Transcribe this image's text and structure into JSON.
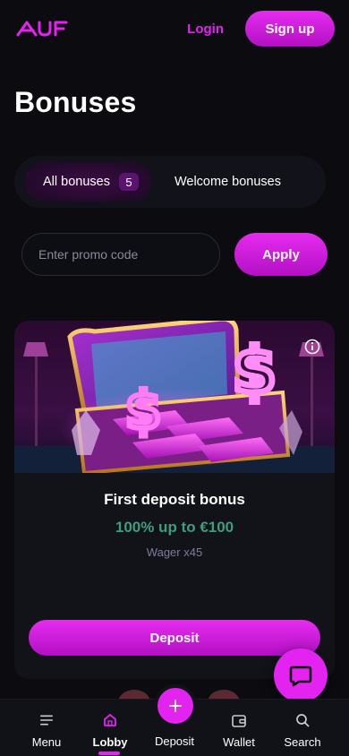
{
  "header": {
    "logo_text": "AUF",
    "login_label": "Login",
    "signup_label": "Sign up"
  },
  "page": {
    "title": "Bonuses"
  },
  "tabs": [
    {
      "label": "All bonuses",
      "count": "5",
      "active": true
    },
    {
      "label": "Welcome bonuses",
      "active": false
    }
  ],
  "promo": {
    "placeholder": "Enter promo code",
    "value": "",
    "apply_label": "Apply"
  },
  "bonus_card": {
    "title": "First deposit bonus",
    "amount": "100% up to €100",
    "wager": "Wager x45",
    "button_label": "Deposit",
    "info_icon": "info-icon"
  },
  "bottom_nav": {
    "items": [
      {
        "label": "Menu",
        "icon": "menu-icon"
      },
      {
        "label": "Lobby",
        "icon": "home-icon",
        "active": true
      },
      {
        "label": "Deposit",
        "icon": "plus-icon"
      },
      {
        "label": "Wallet",
        "icon": "wallet-icon"
      },
      {
        "label": "Search",
        "icon": "search-icon"
      }
    ]
  },
  "colors": {
    "accent": "#e323f0",
    "background": "#0b0b10",
    "card": "#121219",
    "amount_green": "#3e9e7c",
    "wager_gray": "#7d7d9a"
  }
}
